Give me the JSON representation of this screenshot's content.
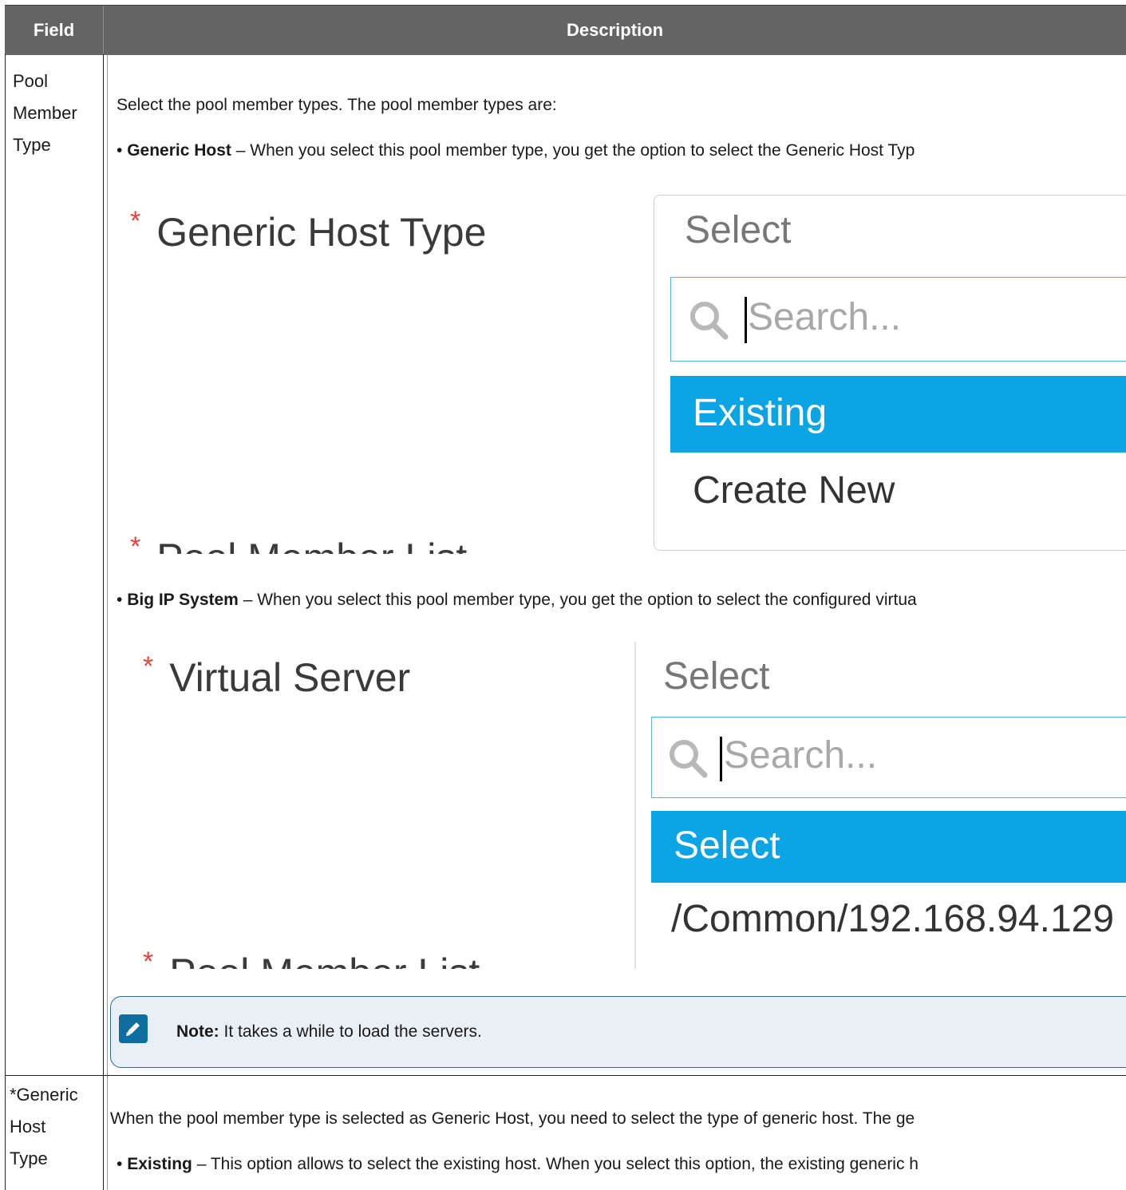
{
  "header": {
    "field": "Field",
    "description": "Description"
  },
  "row1": {
    "field_lines": [
      "Pool",
      "Member",
      "Type"
    ],
    "intro": "Select the pool member types. The pool member types are:",
    "generic_term": "Generic Host",
    "generic_text": " – When you select this pool member type, you get the option to select the Generic Host Typ",
    "shot1": {
      "star": "*",
      "label": "Generic Host Type",
      "placeholder": "Select",
      "search_placeholder": "Search...",
      "selected_option": "Existing",
      "option": "Create New",
      "cut_label": "Pool Member List"
    },
    "bigip_term": "Big IP System",
    "bigip_text": " – When you select this pool member type, you get the option to select the configured virtua",
    "shot2": {
      "star": "*",
      "label": "Virtual Server",
      "placeholder": "Select",
      "search_placeholder": "Search...",
      "selected_option": "Select",
      "option": "/Common/192.168.94.129",
      "cut_label": "Pool Member List"
    },
    "note_label": "Note:",
    "note_text": " It takes a while to load the servers."
  },
  "row2": {
    "field_lines": [
      "*Generic",
      "Host",
      "Type"
    ],
    "intro": "When the pool member type is selected as Generic Host, you need to select the type of generic host. The ge",
    "existing_term": "Existing",
    "existing_text": " – This option allows to select the existing host. When you select this option, the existing generic h"
  },
  "colors": {
    "header_bg": "#646464",
    "selected_bg": "#0ba5e5",
    "required_star": "#e0443c",
    "note_bg": "#e8f0f5",
    "note_border": "#2c6c93"
  }
}
